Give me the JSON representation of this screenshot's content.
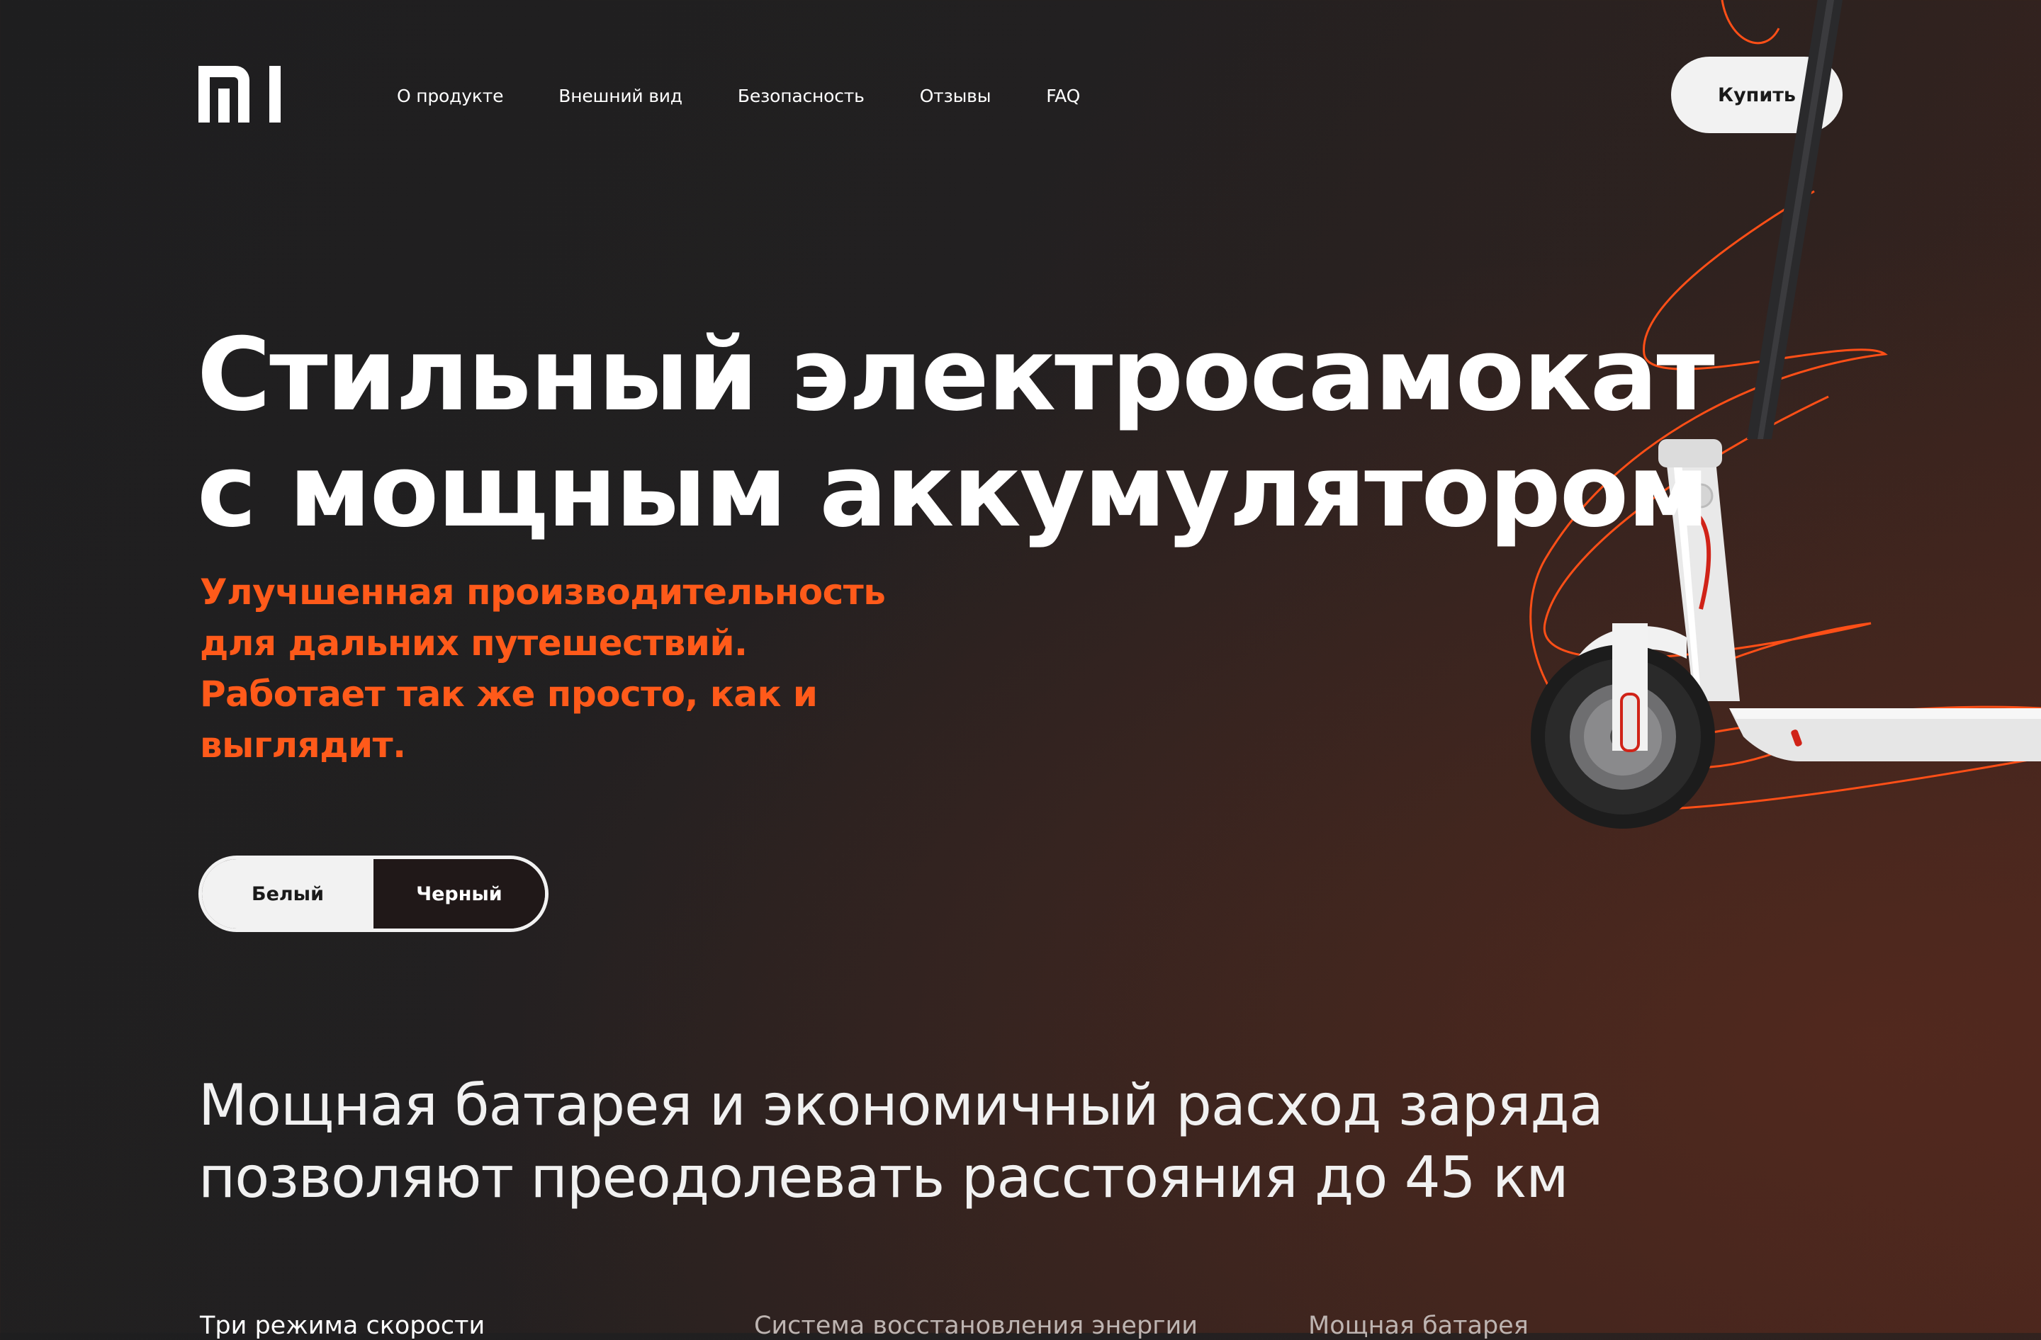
{
  "brand": {
    "logo_text": "mi",
    "accent_color": "#ff5a1a"
  },
  "nav": {
    "items": [
      {
        "label": "О продукте"
      },
      {
        "label": "Внешний вид"
      },
      {
        "label": "Безопасность"
      },
      {
        "label": "Отзывы"
      },
      {
        "label": "FAQ"
      }
    ]
  },
  "header": {
    "buy_label": "Купить"
  },
  "hero": {
    "title_lines": [
      "Стильный электросамокат",
      "с мощным аккумулятором"
    ],
    "subtitle_lines": [
      "Улучшенная производительность",
      "для дальних путешествий.",
      "Работает так же просто, как и",
      "выглядит."
    ],
    "color_options": {
      "white": "Белый",
      "black": "Черный",
      "selected": "Черный"
    }
  },
  "section": {
    "title_lines": [
      "Мощная батарея и экономичный расход заряда",
      "позволяют преодолевать расстояния до 45 км"
    ]
  },
  "features": [
    {
      "label": "Три режима скорости"
    },
    {
      "label": "Система восстановления энергии"
    },
    {
      "label": "Мощная батарея"
    }
  ]
}
